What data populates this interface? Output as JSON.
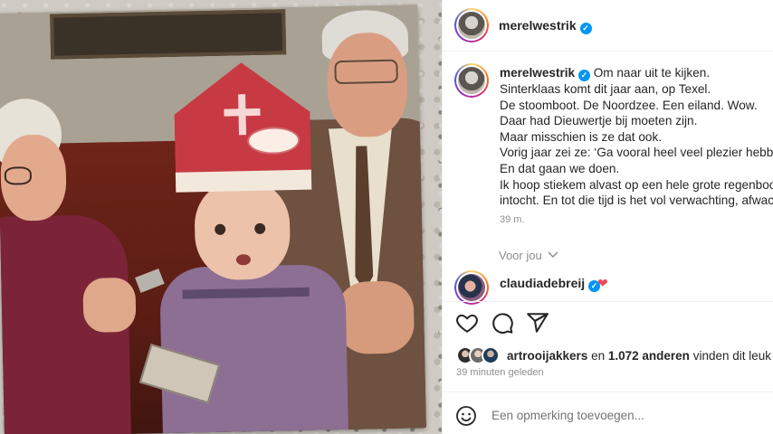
{
  "post": {
    "username": "merelwestrik",
    "verified": true
  },
  "caption": {
    "author": "merelwestrik",
    "lines": [
      "Om naar uit te kijken.",
      "Sinterklaas komt dit jaar aan, op Texel.",
      "De stoomboot. De Noordzee. Een eiland. Wow.",
      "Daar had Dieuwertje bij moeten zijn.",
      "Maar misschien is ze dat ook.",
      "Vorig jaar zei ze: ‘Ga vooral heel veel plezier hebbe",
      "En dat gaan we doen.",
      "Ik hoop stiekem alvast op een hele grote regenboo",
      "intocht. En tot die tijd is het vol verwachting, afwac"
    ],
    "time": "39 m."
  },
  "for_you": {
    "label": "Voor jou"
  },
  "comment": {
    "username": "claudiadebreij",
    "verified": true,
    "text": "❤"
  },
  "actions": {
    "like_icon": "heart-icon",
    "comment_icon": "comment-icon",
    "share_icon": "share-icon"
  },
  "likes": {
    "first_liker": "artrooijakkers",
    "connector": "en",
    "count": "1.072 anderen",
    "suffix": "vinden dit leuk"
  },
  "posted": "39 minuten geleden",
  "add_comment": {
    "placeholder": "Een opmerking toevoegen..."
  },
  "colors": {
    "verified": "#0095f6",
    "heart": "#ed4956",
    "muted": "#8e8e8e",
    "text": "#262626"
  }
}
